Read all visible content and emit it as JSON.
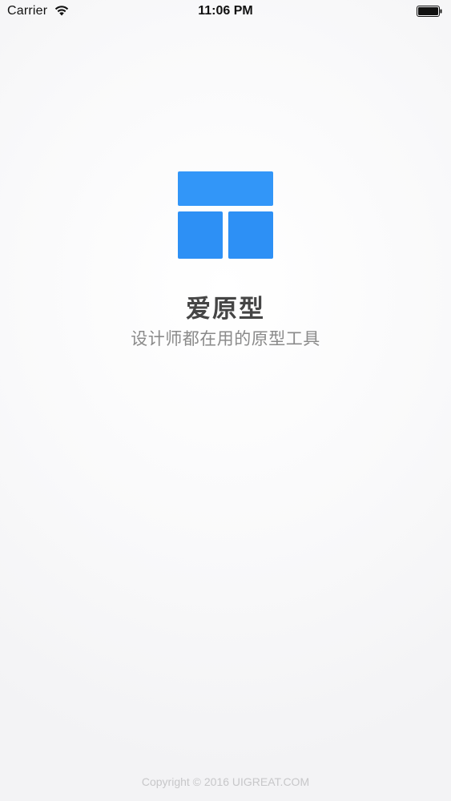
{
  "status_bar": {
    "carrier": "Carrier",
    "time": "11:06 PM",
    "wifi_icon": "wifi-icon",
    "battery_icon": "battery-icon"
  },
  "logo": {
    "icon": "layout-logo-icon",
    "color": "#3296f8"
  },
  "app": {
    "name": "爱原型",
    "tagline": "设计师都在用的原型工具"
  },
  "footer": {
    "copyright": "Copyright © 2016 UIGREAT.COM"
  }
}
